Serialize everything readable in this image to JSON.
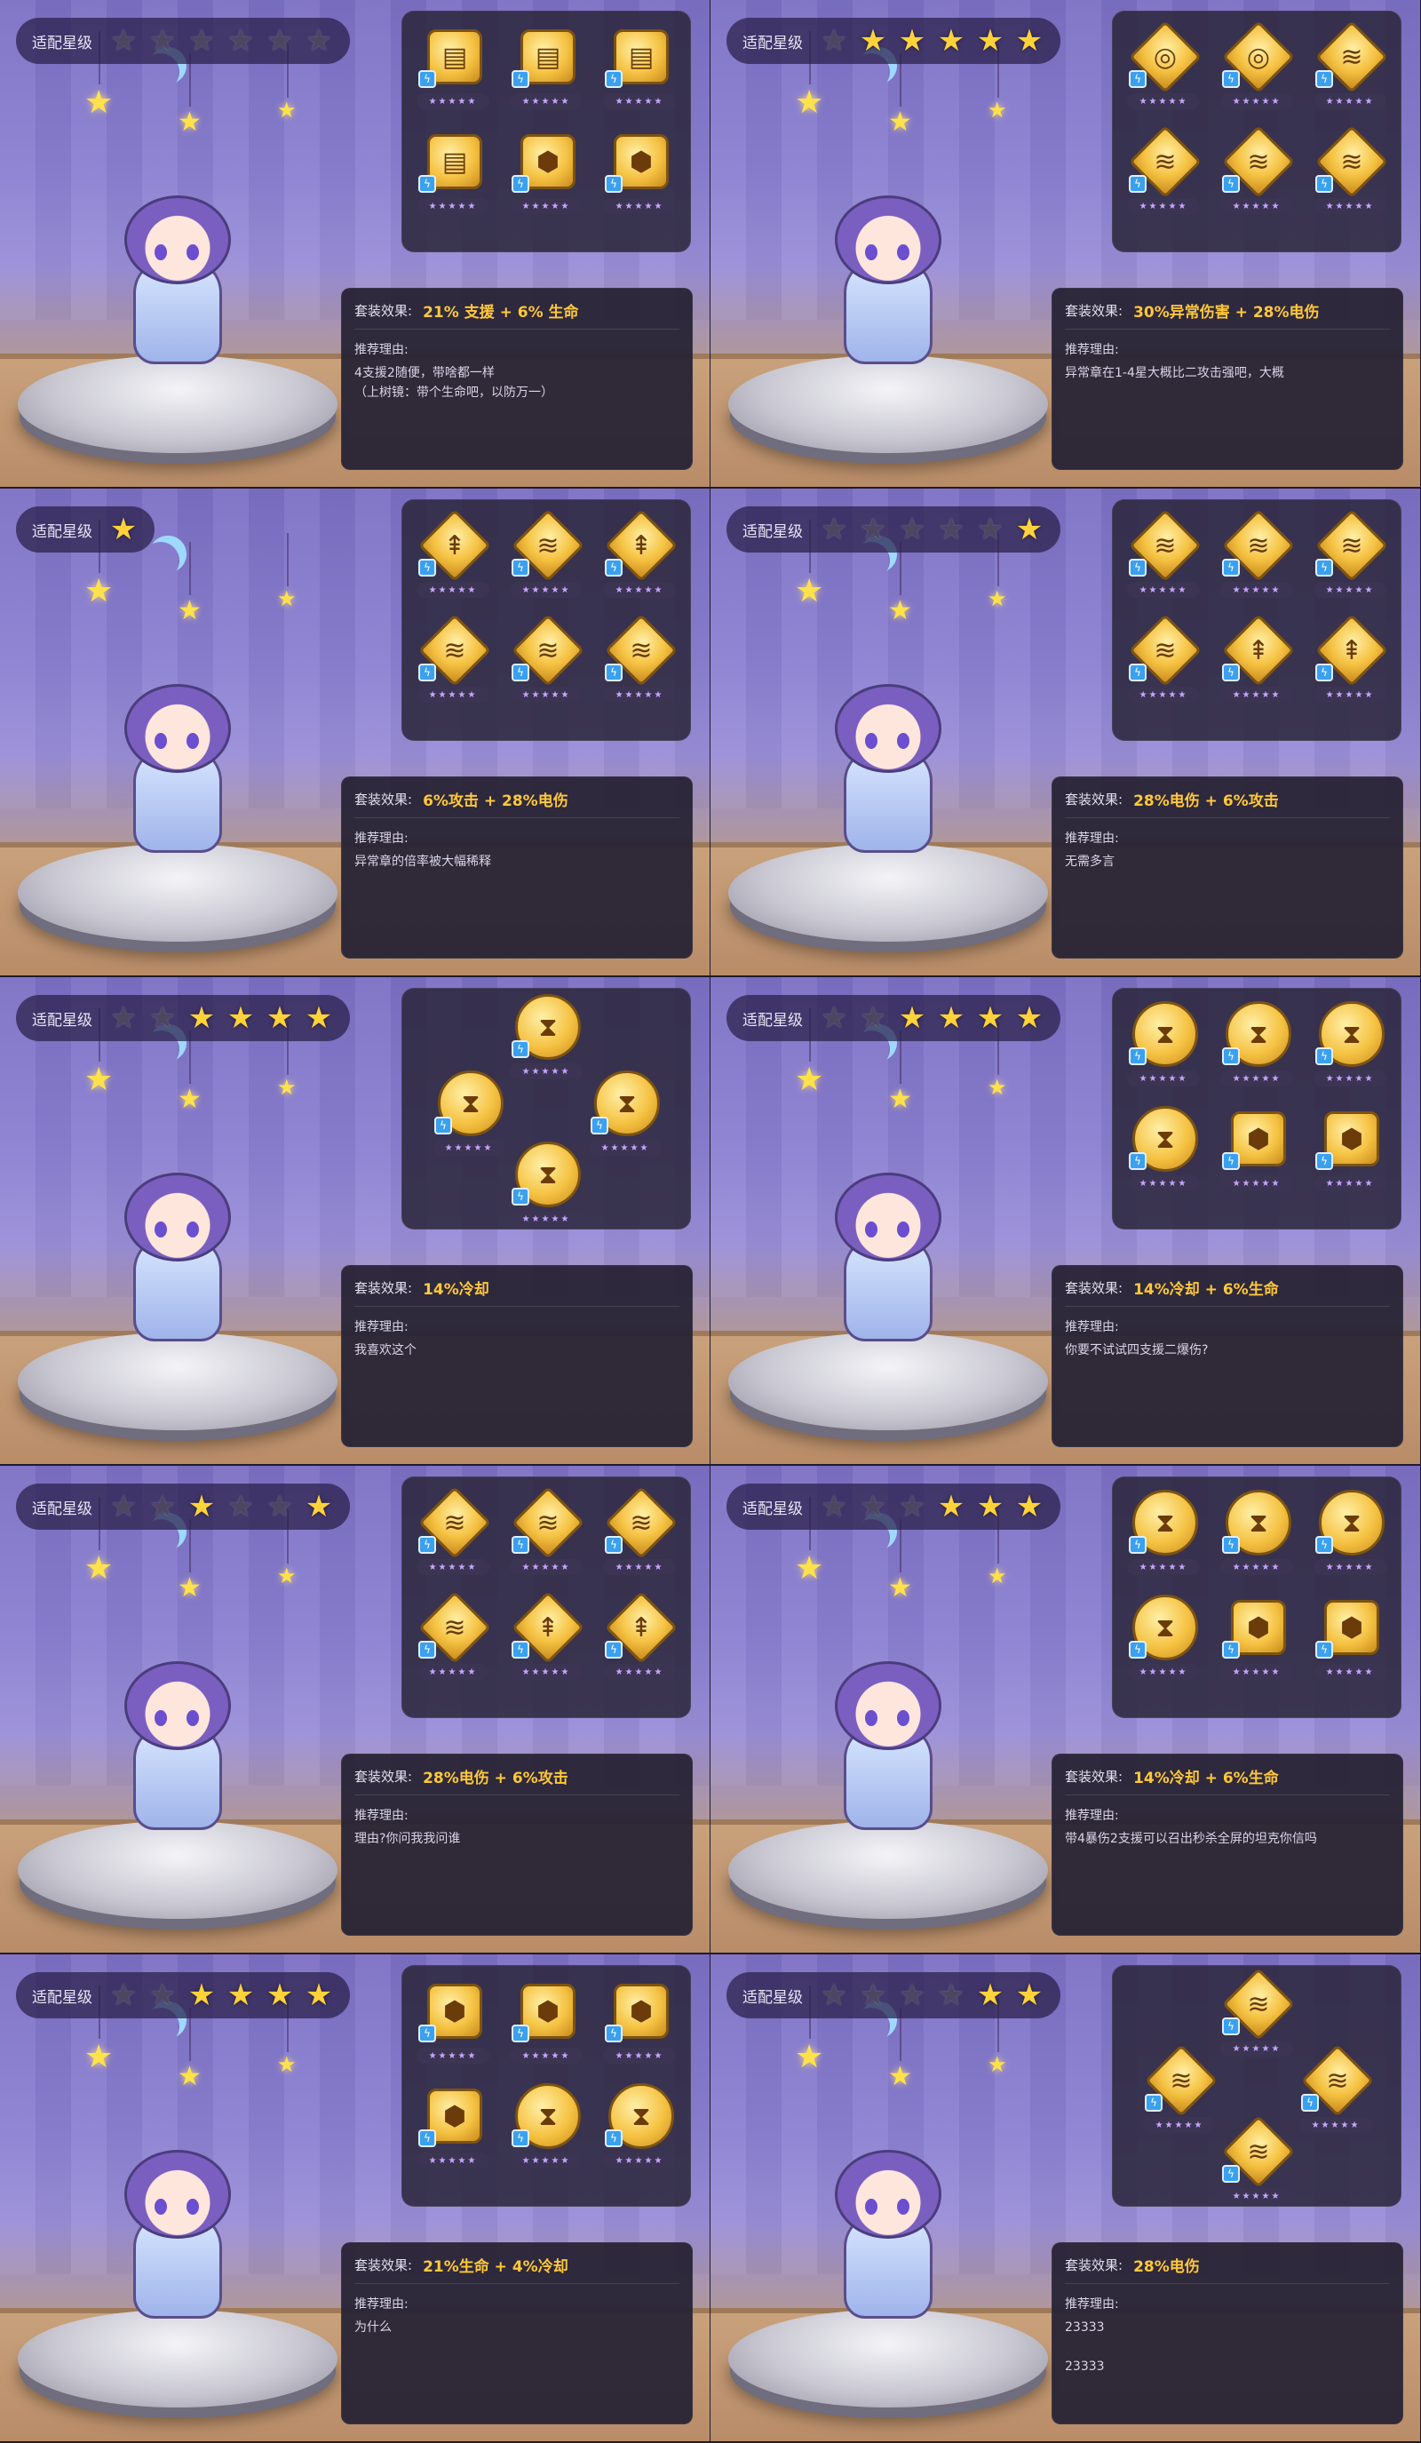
{
  "rating_label": "适配星级",
  "effect_label": "套装效果:",
  "reason_label": "推荐理由:",
  "cards": [
    {
      "stars": [
        0,
        0,
        0,
        0,
        0,
        0
      ],
      "discs": [
        "tape",
        "tape",
        "tape",
        "tape",
        "shield",
        "shield"
      ],
      "disc_layout": "grid",
      "effect": "21% 支援 + 6% 生命",
      "reason": "4支援2随便，带啥都一样\n（上树镜：带个生命吧，以防万一）"
    },
    {
      "stars": [
        0,
        1,
        1,
        1,
        1,
        1
      ],
      "discs": [
        "spiral",
        "spiral",
        "wing",
        "wing",
        "wing",
        "wing"
      ],
      "disc_layout": "grid",
      "effect": "30%异常伤害 + 28%电伤",
      "reason": "异常章在1-4星大概比二攻击强吧，大概"
    },
    {
      "stars": [
        1
      ],
      "discs": [
        "blade",
        "wing",
        "blade",
        "wing",
        "wing",
        "wing"
      ],
      "disc_layout": "grid",
      "effect": "6%攻击 + 28%电伤",
      "reason": "异常章的倍率被大幅稀释"
    },
    {
      "stars": [
        0,
        0,
        0,
        0,
        0,
        1
      ],
      "discs": [
        "wing",
        "wing",
        "wing",
        "wing",
        "blade",
        "blade"
      ],
      "disc_layout": "grid",
      "effect": "28%电伤 + 6%攻击",
      "reason": "无需多言"
    },
    {
      "stars": [
        0,
        0,
        1,
        1,
        1,
        1
      ],
      "discs": [
        "hourglass",
        "hourglass",
        "hourglass",
        "hourglass"
      ],
      "disc_layout": "diamond",
      "effect": "14%冷却",
      "reason": "我喜欢这个"
    },
    {
      "stars": [
        0,
        0,
        1,
        1,
        1,
        1
      ],
      "discs": [
        "hourglass",
        "hourglass",
        "hourglass",
        "hourglass",
        "shield",
        "shield"
      ],
      "disc_layout": "grid",
      "effect": "14%冷却 + 6%生命",
      "reason": "你要不试试四支援二爆伤?"
    },
    {
      "stars": [
        0,
        0,
        1,
        0,
        0,
        1
      ],
      "discs": [
        "wing",
        "wing",
        "wing",
        "wing",
        "blade",
        "blade"
      ],
      "disc_layout": "grid",
      "effect": "28%电伤 + 6%攻击",
      "reason": "理由?你问我我问谁"
    },
    {
      "stars": [
        0,
        0,
        0,
        1,
        1,
        1
      ],
      "discs": [
        "hourglass",
        "hourglass",
        "hourglass",
        "hourglass",
        "shield",
        "shield"
      ],
      "disc_layout": "grid",
      "effect": "14%冷却 + 6%生命",
      "reason": "带4暴伤2支援可以召出秒杀全屏的坦克你信吗"
    },
    {
      "stars": [
        0,
        0,
        1,
        1,
        1,
        1
      ],
      "discs": [
        "shield",
        "shield",
        "shield",
        "shield",
        "hourglass",
        "hourglass"
      ],
      "disc_layout": "grid",
      "effect": "21%生命 + 4%冷却",
      "reason": "为什么"
    },
    {
      "stars": [
        0,
        0,
        0,
        0,
        1,
        1
      ],
      "discs": [
        "wing",
        "wing",
        "wing",
        "wing"
      ],
      "disc_layout": "diamond",
      "effect": "28%电伤",
      "reason": "23333\n\n23333"
    }
  ],
  "disc_glyphs": {
    "tape": "▤",
    "shield": "⬢",
    "spiral": "◎",
    "wing": "≋",
    "blade": "⇞",
    "hourglass": "⧗"
  },
  "colors": {
    "accent": "#ffc83a",
    "star_on": "#ffd23a",
    "panel": "#2c283e"
  }
}
